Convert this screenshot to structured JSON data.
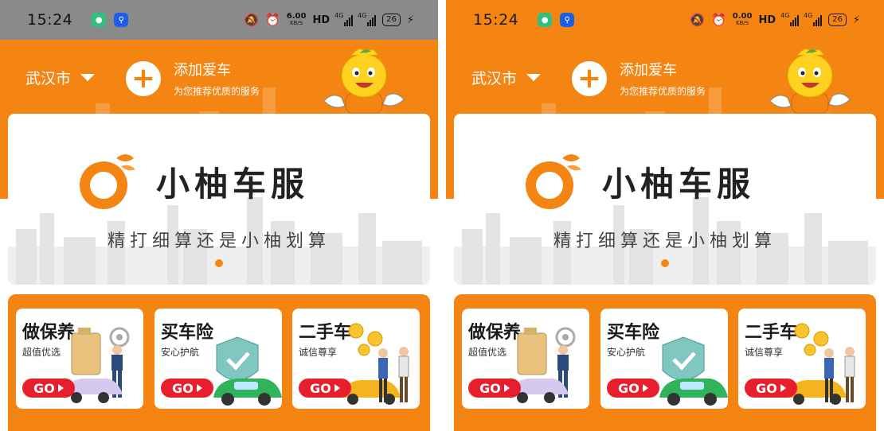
{
  "screens": [
    {
      "status": {
        "time": "15:24",
        "speed": "6.00",
        "speed_unit": "KB/S",
        "hd": "HD",
        "sig1": "4G",
        "sig2": "4G",
        "battery": "26"
      },
      "city": "武汉市",
      "add_car": {
        "title": "添加爱车",
        "subtitle": "为您推荐优质的服务"
      },
      "banner": {
        "brand": "小柚车服",
        "slogan": "精打细算还是小柚划算"
      },
      "services": [
        {
          "title": "做保养",
          "subtitle": "超值优选",
          "go": "GO"
        },
        {
          "title": "买车险",
          "subtitle": "安心护航",
          "go": "GO"
        },
        {
          "title": "二手车",
          "subtitle": "诚信尊享",
          "go": "GO"
        }
      ]
    },
    {
      "status": {
        "time": "15:24",
        "speed": "0.00",
        "speed_unit": "KB/S",
        "hd": "HD",
        "sig1": "4G",
        "sig2": "4G",
        "battery": "26"
      },
      "city": "武汉市",
      "add_car": {
        "title": "添加爱车",
        "subtitle": "为您推荐优质的服务"
      },
      "banner": {
        "brand": "小柚车服",
        "slogan": "精打细算还是小柚划算"
      },
      "services": [
        {
          "title": "做保养",
          "subtitle": "超值优选",
          "go": "GO"
        },
        {
          "title": "买车险",
          "subtitle": "安心护航",
          "go": "GO"
        },
        {
          "title": "二手车",
          "subtitle": "诚信尊享",
          "go": "GO"
        }
      ]
    }
  ],
  "colors": {
    "brand_orange": "#f58513",
    "go_red": "#e61e2d",
    "card_white": "#ffffff"
  },
  "icons": [
    "message-app-icon",
    "usb-icon",
    "mute-icon",
    "alarm-icon",
    "signal-icon",
    "battery-icon",
    "caret-down-icon",
    "plus-icon",
    "mascot-icon",
    "logo-icon",
    "go-arrow-icon"
  ]
}
